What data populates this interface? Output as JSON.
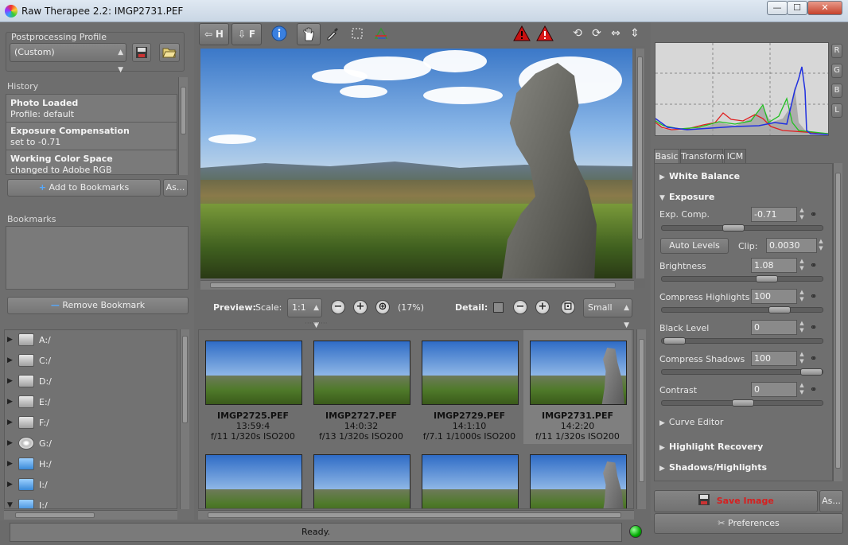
{
  "window": {
    "title": "Raw Therapee 2.2: IMGP2731.PEF",
    "min_glyph": "—",
    "max_glyph": "☐",
    "close_glyph": "✕"
  },
  "left_panel": {
    "profile": {
      "label": "Postprocessing Profile",
      "value": "(Custom)",
      "save_icon": "save-icon",
      "open_icon": "folder-open-icon"
    },
    "history": {
      "label": "History",
      "items": [
        {
          "title": "Photo Loaded",
          "subtitle": "Profile: default"
        },
        {
          "title": "Exposure Compensation",
          "subtitle": "set to -0.71"
        },
        {
          "title": "Working Color Space",
          "subtitle": "changed to Adobe RGB"
        }
      ],
      "add_bookmark": "Add to Bookmarks",
      "as_button": "As..."
    },
    "bookmarks": {
      "label": "Bookmarks",
      "remove_button": "Remove Bookmark"
    },
    "drives": [
      {
        "name": "A:/",
        "icon": "floppy-drive-icon"
      },
      {
        "name": "C:/",
        "icon": "hard-drive-icon"
      },
      {
        "name": "D:/",
        "icon": "hard-drive-icon"
      },
      {
        "name": "E:/",
        "icon": "hard-drive-icon"
      },
      {
        "name": "F:/",
        "icon": "hard-drive-icon"
      },
      {
        "name": "G:/",
        "icon": "cd-drive-icon"
      },
      {
        "name": "H:/",
        "icon": "usb-drive-icon"
      },
      {
        "name": "I:/",
        "icon": "usb-drive-icon"
      },
      {
        "name": "J:/",
        "icon": "usb-drive-icon"
      }
    ]
  },
  "toolbar": {
    "hide_h": "H",
    "hide_f": "F",
    "info_icon": "info-icon",
    "hand_icon": "hand-icon",
    "picker_icon": "color-picker-icon",
    "crop_icon": "crop-icon",
    "straighten_icon": "straighten-icon",
    "warn_shadow_icon": "shadow-clipping-warning-icon",
    "warn_highlight_icon": "highlight-clipping-warning-icon",
    "rotate_left_icon": "rotate-left-icon",
    "rotate_right_icon": "rotate-right-icon",
    "flip_h_icon": "flip-horizontal-icon",
    "flip_v_icon": "flip-vertical-icon"
  },
  "preview_bar": {
    "preview_label": "Preview:",
    "scale_label": "Scale:",
    "scale_value": "1:1",
    "zoom_percent": "(17%)",
    "detail_label": "Detail:",
    "detail_size": "Small"
  },
  "thumbnails": [
    {
      "name": "IMGP2725.PEF",
      "time": "13:59:4",
      "exif": "f/11 1/320s ISO200"
    },
    {
      "name": "IMGP2727.PEF",
      "time": "14:0:32",
      "exif": "f/13 1/320s ISO200"
    },
    {
      "name": "IMGP2729.PEF",
      "time": "14:1:10",
      "exif": "f/7.1 1/1000s ISO200"
    },
    {
      "name": "IMGP2731.PEF",
      "time": "14:2:20",
      "exif": "f/11 1/320s ISO200"
    }
  ],
  "histogram": {
    "buttons": [
      "R",
      "G",
      "B",
      "L"
    ]
  },
  "tabs": [
    "Basic",
    "Transform",
    "ICM"
  ],
  "basic": {
    "white_balance": "White Balance",
    "exposure": "Exposure",
    "exp_comp_label": "Exp. Comp.",
    "exp_comp_value": "-0.71",
    "auto_levels": "Auto Levels",
    "clip_label": "Clip:",
    "clip_value": "0.0030",
    "brightness_label": "Brightness",
    "brightness_value": "1.08",
    "compress_highlights_label": "Compress Highlights",
    "compress_highlights_value": "100",
    "black_level_label": "Black Level",
    "black_level_value": "0",
    "compress_shadows_label": "Compress Shadows",
    "compress_shadows_value": "100",
    "contrast_label": "Contrast",
    "contrast_value": "0",
    "curve_editor": "Curve Editor",
    "highlight_recovery": "Highlight Recovery",
    "shadows_highlights": "Shadows/Highlights"
  },
  "actions": {
    "save_image": "Save Image",
    "save_as": "As...",
    "preferences": "Preferences"
  },
  "status": {
    "text": "Ready."
  },
  "colors": {
    "panel_bg": "#6e6e6e",
    "save_red": "#d62020",
    "status_green": "#00aa00"
  }
}
